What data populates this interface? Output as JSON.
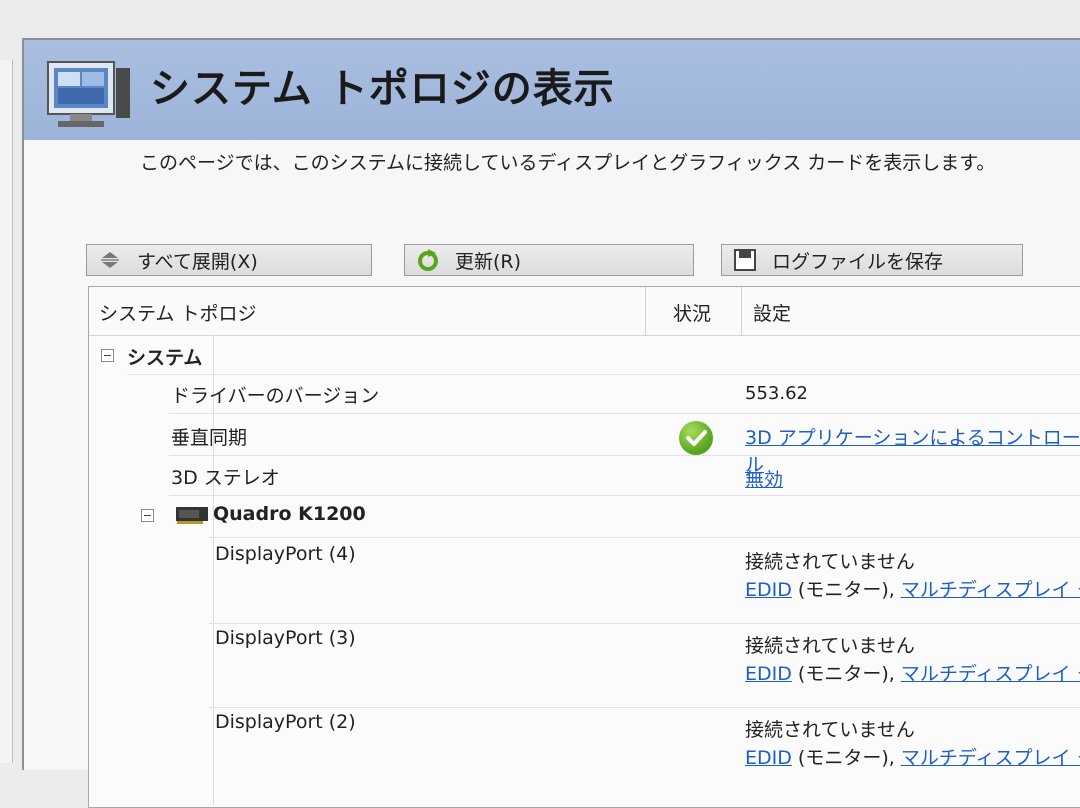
{
  "header": {
    "title": "システム トポロジの表示",
    "description": "このページでは、このシステムに接続しているディスプレイとグラフィックス カードを表示します。"
  },
  "toolbar": {
    "expand_label": "すべて展開(X)",
    "refresh_label": "更新(R)",
    "save_log_label": "ログファイルを保存"
  },
  "table": {
    "columns": [
      "システム トポロジ",
      "状況",
      "設定"
    ],
    "system_label": "システム",
    "driver_version_label": "ドライバーのバージョン",
    "driver_version_value": "553.62",
    "vsync_label": "垂直同期",
    "vsync_value": "3D アプリケーションによるコントロール",
    "stereo_label": "3D ステレオ",
    "stereo_value": "無効",
    "gpu_name": "Quadro K1200",
    "ports": [
      {
        "name": "DisplayPort (4)",
        "status": "接続されていません",
        "edid": "EDID",
        "monitor": "(モニター),",
        "multi": "マルチディスプレイ クロ"
      },
      {
        "name": "DisplayPort (3)",
        "status": "接続されていません",
        "edid": "EDID",
        "monitor": "(モニター),",
        "multi": "マルチディスプレイ クロ"
      },
      {
        "name": "DisplayPort (2)",
        "status": "接続されていません",
        "edid": "EDID",
        "monitor": "(モニター),",
        "multi": "マルチディスプレイ クロ"
      }
    ]
  },
  "colors": {
    "banner": "#9db4da",
    "link": "#1d5fc9",
    "check": "#56a11d"
  },
  "icons": [
    "display-settings-icon",
    "expand-icon",
    "refresh-icon",
    "save-icon",
    "collapse-icon",
    "gpu-card-icon",
    "check-icon"
  ]
}
